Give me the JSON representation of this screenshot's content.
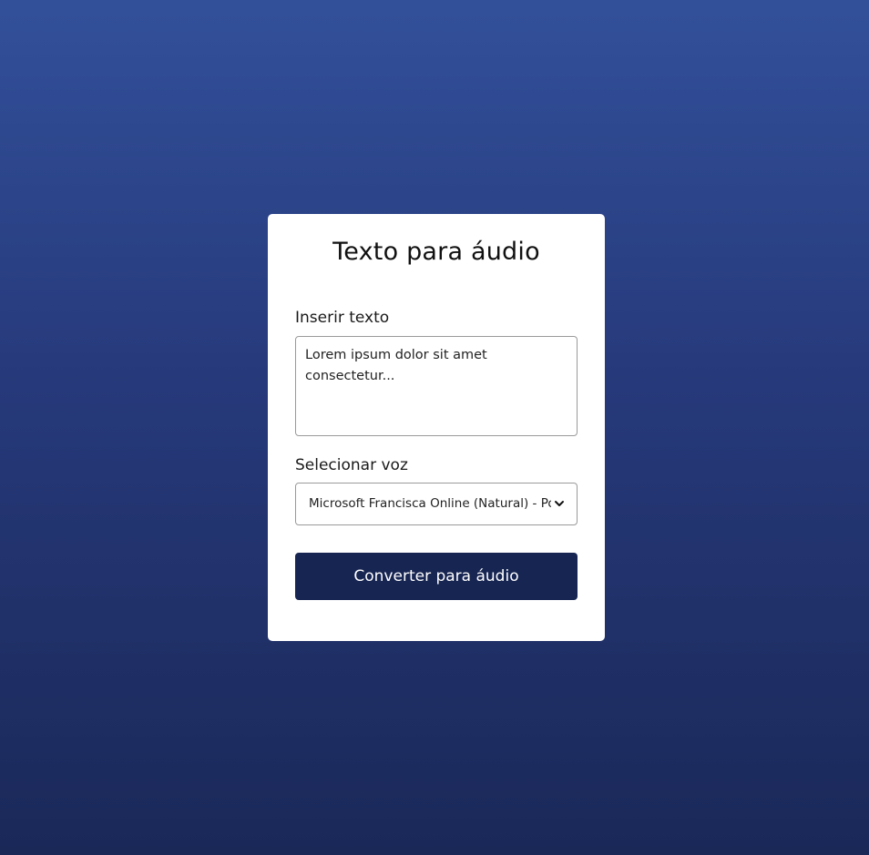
{
  "card": {
    "title": "Texto para áudio",
    "text_input": {
      "label": "Inserir texto",
      "value": "Lorem ipsum dolor sit amet consectetur..."
    },
    "voice_select": {
      "label": "Selecionar voz",
      "selected": "Microsoft Francisca Online (Natural) - Portuguese (Brazil)",
      "icon": "chevron-down-icon"
    },
    "convert_button": {
      "label": "Converter para áudio",
      "color": "#172552"
    }
  },
  "colors": {
    "background_top": "#32509a",
    "background_bottom": "#1a2858",
    "card": "#ffffff"
  }
}
